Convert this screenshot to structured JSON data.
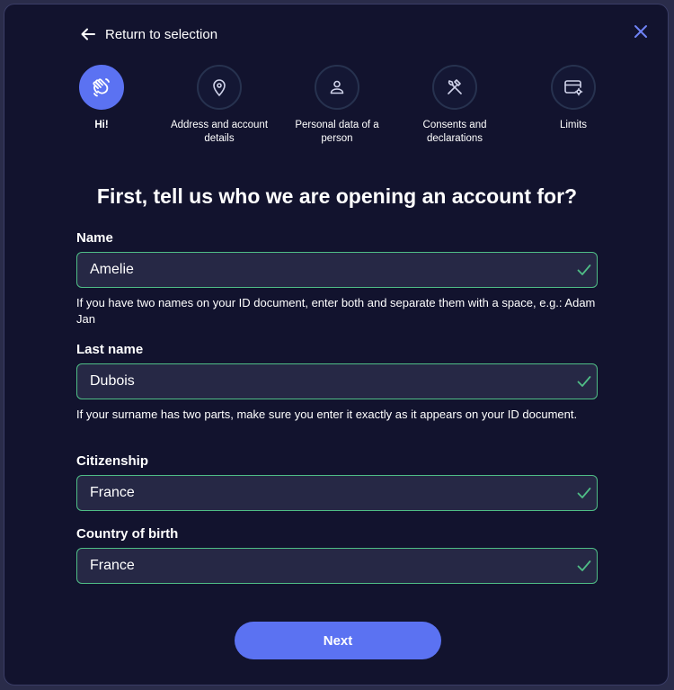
{
  "header": {
    "back_label": "Return to selection"
  },
  "steps": [
    {
      "label": "Hi!",
      "icon": "wave-hand-icon",
      "active": true
    },
    {
      "label": "Address and account details",
      "icon": "location-pin-icon",
      "active": false
    },
    {
      "label": "Personal data of a person",
      "icon": "person-icon",
      "active": false
    },
    {
      "label": "Consents and declarations",
      "icon": "tools-icon",
      "active": false
    },
    {
      "label": "Limits",
      "icon": "card-settings-icon",
      "active": false
    }
  ],
  "form": {
    "title": "First, tell us who we are opening an account for?",
    "name": {
      "label": "Name",
      "value": "Amelie",
      "hint": "If you have two names on your ID document, enter both and separate them with a space, e.g.: Adam Jan"
    },
    "last_name": {
      "label": "Last name",
      "value": "Dubois",
      "hint": "If your surname has two parts, make sure you enter it exactly as it appears on your ID document."
    },
    "citizenship": {
      "label": "Citizenship",
      "value": "France"
    },
    "country_of_birth": {
      "label": "Country of birth",
      "value": "France"
    },
    "next_label": "Next"
  },
  "colors": {
    "accent": "#5b72f2",
    "valid_border": "#4fbd86",
    "background": "#12132e"
  }
}
